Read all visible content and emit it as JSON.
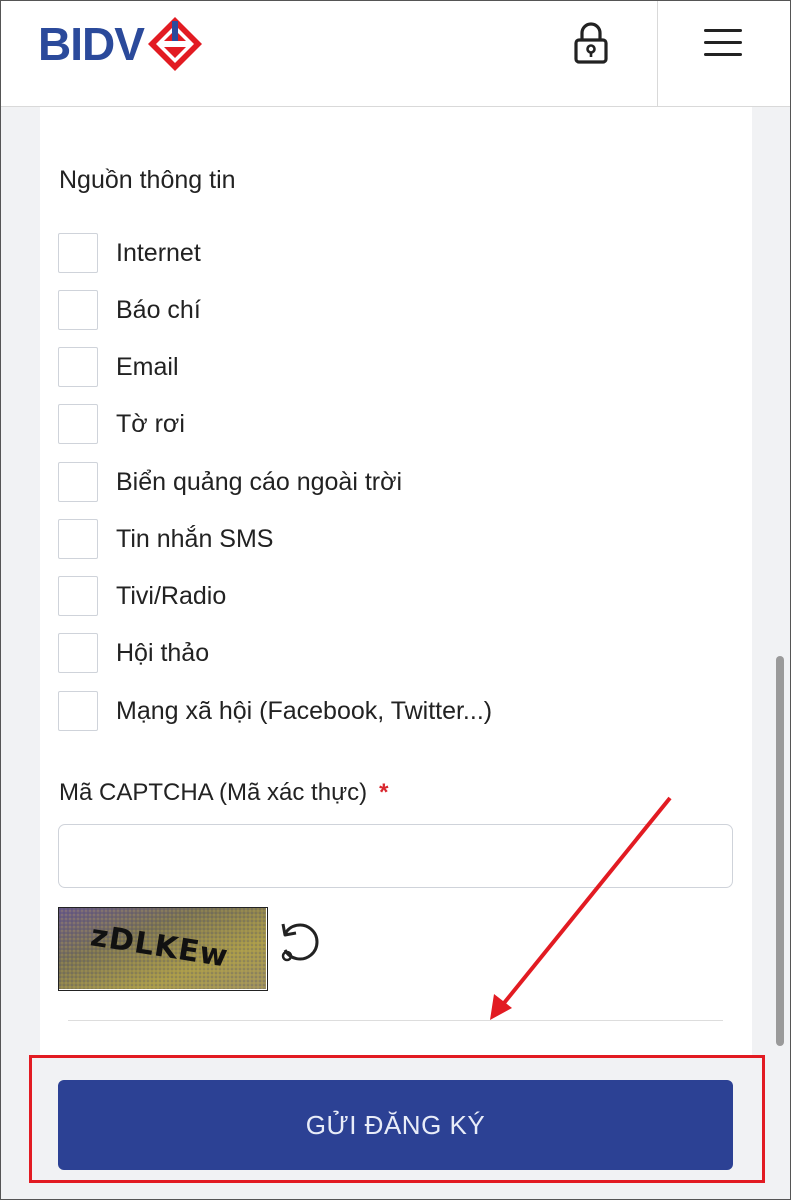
{
  "header": {
    "logo_text": "BIDV",
    "lock_icon": "lock-icon",
    "menu_icon": "hamburger-menu-icon"
  },
  "form": {
    "section_title": "Nguồn thông tin",
    "sources": [
      {
        "label": "Internet",
        "checked": false
      },
      {
        "label": "Báo chí",
        "checked": false
      },
      {
        "label": "Email",
        "checked": false
      },
      {
        "label": "Tờ rơi",
        "checked": false
      },
      {
        "label": "Biển quảng cáo ngoài trời",
        "checked": false
      },
      {
        "label": "Tin nhắn SMS",
        "checked": false
      },
      {
        "label": "Tivi/Radio",
        "checked": false
      },
      {
        "label": "Hội thảo",
        "checked": false
      },
      {
        "label": "Mạng xã hội (Facebook, Twitter...)",
        "checked": false
      }
    ],
    "captcha_label": "Mã CAPTCHA (Mã xác thực)",
    "required_mark": "*",
    "captcha_value": "",
    "captcha_text": "zDLKEw",
    "refresh_icon": "refresh-icon",
    "submit_label": "GỬI ĐĂNG KÝ"
  },
  "colors": {
    "brand_blue": "#2c4194",
    "logo_blue": "#2b4a9b",
    "logo_red": "#e21b22",
    "annotation_red": "#e21b22"
  }
}
